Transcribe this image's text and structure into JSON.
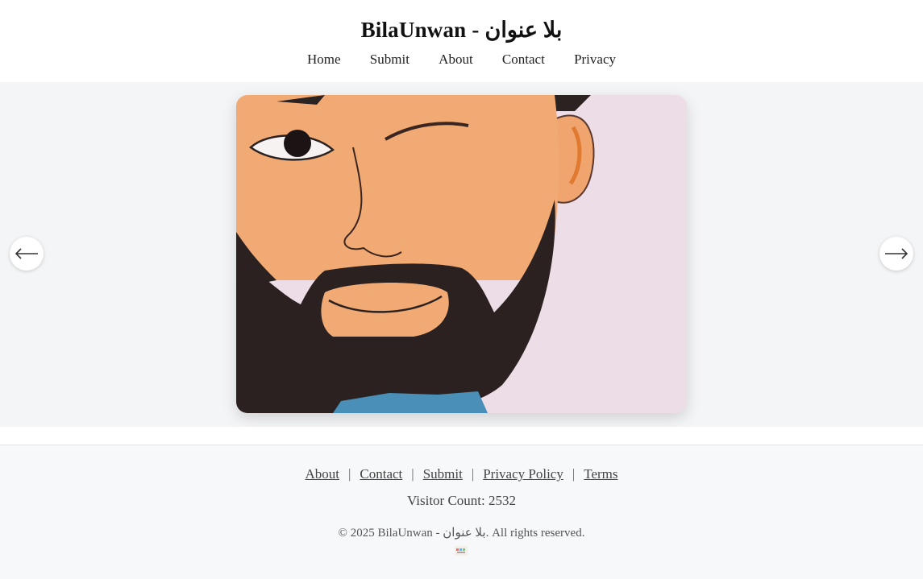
{
  "header": {
    "title": "BilaUnwan - بلا عنوان",
    "nav": [
      "Home",
      "Submit",
      "About",
      "Contact",
      "Privacy"
    ]
  },
  "carousel": {
    "prev_icon": "arrow-left-icon",
    "next_icon": "arrow-right-icon"
  },
  "footer": {
    "links": [
      "About",
      "Contact",
      "Submit",
      "Privacy Policy",
      "Terms"
    ],
    "separator": "|",
    "visitor_label": "Visitor Count: 2532",
    "copyright": "© 2025 BilaUnwan - بلا عنوان. All rights reserved.",
    "badge_icon": "counter-badge-icon"
  },
  "colors": {
    "background": "#f7f8fa",
    "header_bg": "#ffffff",
    "text": "#222222"
  }
}
